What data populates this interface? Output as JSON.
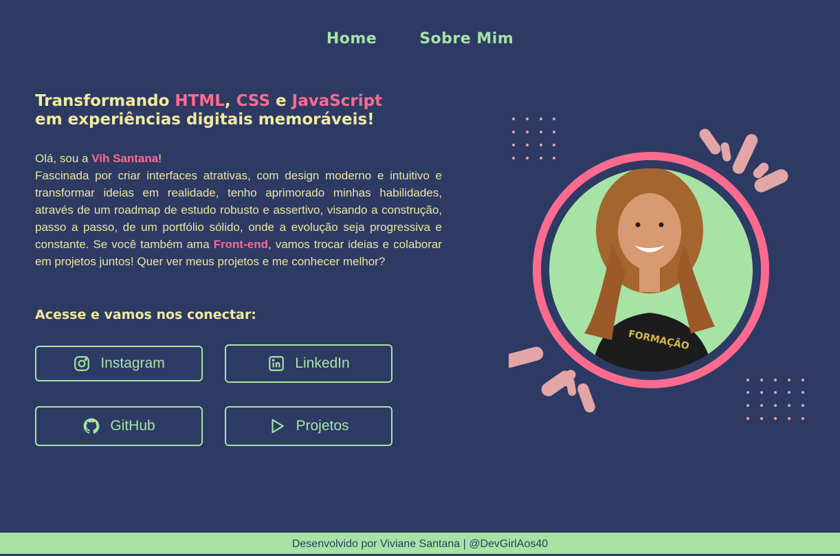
{
  "nav": {
    "home": "Home",
    "about": "Sobre Mim"
  },
  "headline": {
    "prefix": "Transformando ",
    "html": "HTML",
    "comma": ", ",
    "css": "CSS",
    "and": " e ",
    "js": "JavaScript",
    "line2": "em experiências digitais memoráveis!"
  },
  "intro": {
    "greeting_pre": "Olá, sou a ",
    "name": "Vih Santana",
    "greeting_post": "!",
    "body_1": "Fascinada por criar interfaces atrativas, com design moderno e intuitivo e transformar ideias em realidade, tenho aprimorado minhas habilidades, através de um roadmap de estudo robusto e assertivo, visando a construção, passo a passo, de um portfólio sólido, onde a evolução seja progressiva e constante. Se você também ama ",
    "frontend": "Front-end",
    "body_2": ", vamos trocar ideias e colaborar em projetos juntos! Quer ver meus projetos e me conhecer melhor?"
  },
  "connect_title": "Acesse e vamos nos conectar:",
  "buttons": {
    "instagram": "Instagram",
    "linkedin": "LinkedIn",
    "github": "GitHub",
    "projects": "Projetos"
  },
  "footer": "Desenvolvido por Viviane Santana | @DevGirlAos40",
  "colors": {
    "background": "#2d3a64",
    "accent_green": "#a8e3a6",
    "accent_pink": "#ff6b8e",
    "text_yellow": "#f3ea9f"
  }
}
